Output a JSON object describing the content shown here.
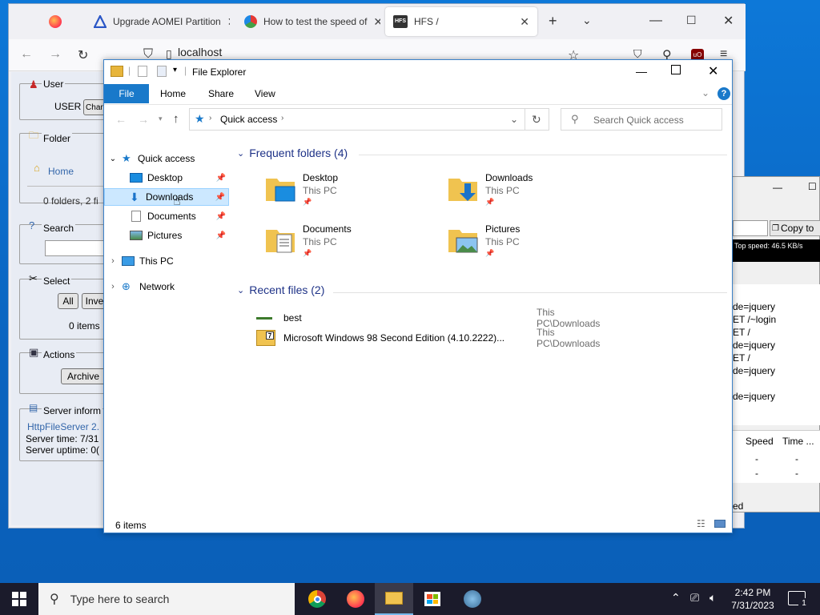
{
  "browser": {
    "tabs": [
      {
        "label": ""
      },
      {
        "label": "Upgrade AOMEI Partition"
      },
      {
        "label": "How to test the speed of"
      },
      {
        "label": "HFS /"
      }
    ],
    "url": "localhost"
  },
  "hfs_page": {
    "user_section": "User",
    "user_name": "USER",
    "change_btn": "Chan",
    "folder_section": "Folder",
    "home_link": "Home",
    "folder_counts": "0 folders, 2 fi",
    "search_section": "Search",
    "select_section": "Select",
    "all_btn": "All",
    "invert_btn": "Inve",
    "items_count": "0 items",
    "actions_section": "Actions",
    "archive_btn": "Archive",
    "server_section": "Server inform",
    "server_link": "HttpFileServer 2.",
    "server_time": "Server time: 7/31",
    "server_uptime": "Server uptime: 0("
  },
  "hfs_app": {
    "copy_btn": "Copy to",
    "top_speed": "Top speed: 46.5 KB/s",
    "log": [
      "de=jquery",
      "ET /~login",
      "ET /",
      "de=jquery",
      "ET /",
      "de=jquery",
      "",
      "de=jquery"
    ],
    "col_speed": "Speed",
    "col_time": "Time ...",
    "rows": [
      [
        "-",
        "-"
      ],
      [
        "-",
        "-"
      ]
    ],
    "status": "ed"
  },
  "explorer": {
    "title": "File Explorer",
    "ribbon_tabs": [
      "File",
      "Home",
      "Share",
      "View"
    ],
    "breadcrumb": "Quick access",
    "search_placeholder": "Search Quick access",
    "nav": {
      "quick_access": "Quick access",
      "desktop": "Desktop",
      "downloads": "Downloads",
      "documents": "Documents",
      "pictures": "Pictures",
      "this_pc": "This PC",
      "network": "Network"
    },
    "frequent_header": "Frequent folders (4)",
    "folders": [
      {
        "name": "Desktop",
        "location": "This PC"
      },
      {
        "name": "Downloads",
        "location": "This PC"
      },
      {
        "name": "Documents",
        "location": "This PC"
      },
      {
        "name": "Pictures",
        "location": "This PC"
      }
    ],
    "recent_header": "Recent files (2)",
    "recent_files": [
      {
        "name": "best",
        "location": "This PC\\Downloads"
      },
      {
        "name": "Microsoft Windows 98 Second Edition (4.10.2222)...",
        "location": "This PC\\Downloads"
      }
    ],
    "status": "6 items"
  },
  "taskbar": {
    "search_placeholder": "Type here to search",
    "time": "2:42 PM",
    "date": "7/31/2023",
    "notification_count": "1"
  }
}
